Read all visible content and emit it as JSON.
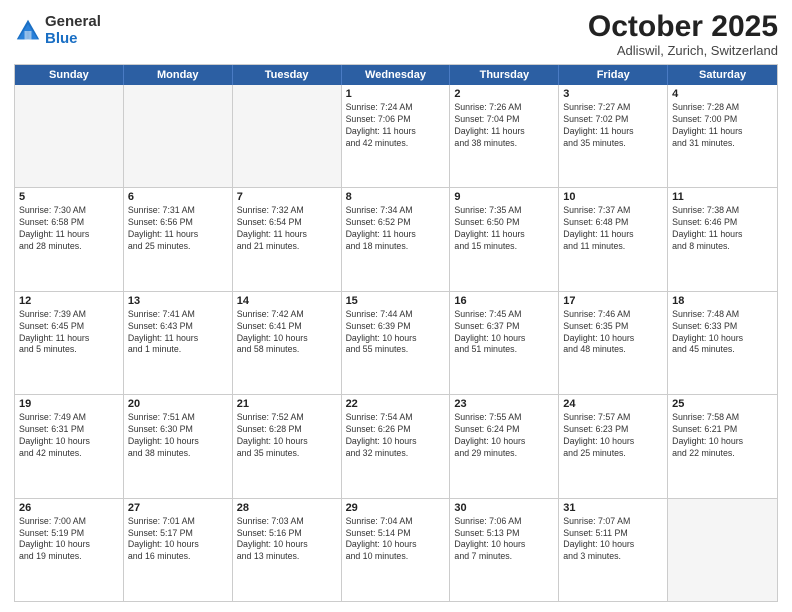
{
  "header": {
    "logo_general": "General",
    "logo_blue": "Blue",
    "month": "October 2025",
    "location": "Adliswil, Zurich, Switzerland"
  },
  "weekdays": [
    "Sunday",
    "Monday",
    "Tuesday",
    "Wednesday",
    "Thursday",
    "Friday",
    "Saturday"
  ],
  "rows": [
    [
      {
        "day": "",
        "text": "",
        "empty": true
      },
      {
        "day": "",
        "text": "",
        "empty": true
      },
      {
        "day": "",
        "text": "",
        "empty": true
      },
      {
        "day": "1",
        "text": "Sunrise: 7:24 AM\nSunset: 7:06 PM\nDaylight: 11 hours\nand 42 minutes."
      },
      {
        "day": "2",
        "text": "Sunrise: 7:26 AM\nSunset: 7:04 PM\nDaylight: 11 hours\nand 38 minutes."
      },
      {
        "day": "3",
        "text": "Sunrise: 7:27 AM\nSunset: 7:02 PM\nDaylight: 11 hours\nand 35 minutes."
      },
      {
        "day": "4",
        "text": "Sunrise: 7:28 AM\nSunset: 7:00 PM\nDaylight: 11 hours\nand 31 minutes."
      }
    ],
    [
      {
        "day": "5",
        "text": "Sunrise: 7:30 AM\nSunset: 6:58 PM\nDaylight: 11 hours\nand 28 minutes."
      },
      {
        "day": "6",
        "text": "Sunrise: 7:31 AM\nSunset: 6:56 PM\nDaylight: 11 hours\nand 25 minutes."
      },
      {
        "day": "7",
        "text": "Sunrise: 7:32 AM\nSunset: 6:54 PM\nDaylight: 11 hours\nand 21 minutes."
      },
      {
        "day": "8",
        "text": "Sunrise: 7:34 AM\nSunset: 6:52 PM\nDaylight: 11 hours\nand 18 minutes."
      },
      {
        "day": "9",
        "text": "Sunrise: 7:35 AM\nSunset: 6:50 PM\nDaylight: 11 hours\nand 15 minutes."
      },
      {
        "day": "10",
        "text": "Sunrise: 7:37 AM\nSunset: 6:48 PM\nDaylight: 11 hours\nand 11 minutes."
      },
      {
        "day": "11",
        "text": "Sunrise: 7:38 AM\nSunset: 6:46 PM\nDaylight: 11 hours\nand 8 minutes."
      }
    ],
    [
      {
        "day": "12",
        "text": "Sunrise: 7:39 AM\nSunset: 6:45 PM\nDaylight: 11 hours\nand 5 minutes."
      },
      {
        "day": "13",
        "text": "Sunrise: 7:41 AM\nSunset: 6:43 PM\nDaylight: 11 hours\nand 1 minute."
      },
      {
        "day": "14",
        "text": "Sunrise: 7:42 AM\nSunset: 6:41 PM\nDaylight: 10 hours\nand 58 minutes."
      },
      {
        "day": "15",
        "text": "Sunrise: 7:44 AM\nSunset: 6:39 PM\nDaylight: 10 hours\nand 55 minutes."
      },
      {
        "day": "16",
        "text": "Sunrise: 7:45 AM\nSunset: 6:37 PM\nDaylight: 10 hours\nand 51 minutes."
      },
      {
        "day": "17",
        "text": "Sunrise: 7:46 AM\nSunset: 6:35 PM\nDaylight: 10 hours\nand 48 minutes."
      },
      {
        "day": "18",
        "text": "Sunrise: 7:48 AM\nSunset: 6:33 PM\nDaylight: 10 hours\nand 45 minutes."
      }
    ],
    [
      {
        "day": "19",
        "text": "Sunrise: 7:49 AM\nSunset: 6:31 PM\nDaylight: 10 hours\nand 42 minutes."
      },
      {
        "day": "20",
        "text": "Sunrise: 7:51 AM\nSunset: 6:30 PM\nDaylight: 10 hours\nand 38 minutes."
      },
      {
        "day": "21",
        "text": "Sunrise: 7:52 AM\nSunset: 6:28 PM\nDaylight: 10 hours\nand 35 minutes."
      },
      {
        "day": "22",
        "text": "Sunrise: 7:54 AM\nSunset: 6:26 PM\nDaylight: 10 hours\nand 32 minutes."
      },
      {
        "day": "23",
        "text": "Sunrise: 7:55 AM\nSunset: 6:24 PM\nDaylight: 10 hours\nand 29 minutes."
      },
      {
        "day": "24",
        "text": "Sunrise: 7:57 AM\nSunset: 6:23 PM\nDaylight: 10 hours\nand 25 minutes."
      },
      {
        "day": "25",
        "text": "Sunrise: 7:58 AM\nSunset: 6:21 PM\nDaylight: 10 hours\nand 22 minutes."
      }
    ],
    [
      {
        "day": "26",
        "text": "Sunrise: 7:00 AM\nSunset: 5:19 PM\nDaylight: 10 hours\nand 19 minutes."
      },
      {
        "day": "27",
        "text": "Sunrise: 7:01 AM\nSunset: 5:17 PM\nDaylight: 10 hours\nand 16 minutes."
      },
      {
        "day": "28",
        "text": "Sunrise: 7:03 AM\nSunset: 5:16 PM\nDaylight: 10 hours\nand 13 minutes."
      },
      {
        "day": "29",
        "text": "Sunrise: 7:04 AM\nSunset: 5:14 PM\nDaylight: 10 hours\nand 10 minutes."
      },
      {
        "day": "30",
        "text": "Sunrise: 7:06 AM\nSunset: 5:13 PM\nDaylight: 10 hours\nand 7 minutes."
      },
      {
        "day": "31",
        "text": "Sunrise: 7:07 AM\nSunset: 5:11 PM\nDaylight: 10 hours\nand 3 minutes."
      },
      {
        "day": "",
        "text": "",
        "empty": true
      }
    ]
  ]
}
